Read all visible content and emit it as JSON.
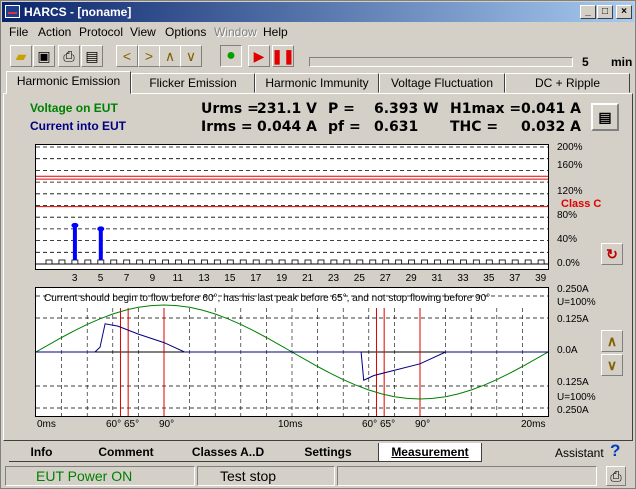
{
  "window": {
    "title": "HARCS - [noname]"
  },
  "menu": [
    "File",
    "Action",
    "Protocol",
    "View",
    "Options",
    "Window",
    "Help"
  ],
  "toolbar": {
    "timer_value": "5",
    "timer_unit": "min"
  },
  "tabs": [
    "Harmonic Emission",
    "Flicker Emission",
    "Harmonic Immunity",
    "Voltage Fluctuation",
    "DC + Ripple"
  ],
  "header": {
    "voltage_label": "Voltage on EUT",
    "current_label": "Current into EUT",
    "urms_label": "Urms =",
    "urms_value": "231.1 V",
    "irms_label": "Irms  =",
    "irms_value": "0.044 A",
    "p_label": "P =",
    "p_value": "6.393 W",
    "pf_label": "pf =",
    "pf_value": "0.631",
    "h1max_label": "H1max =",
    "h1max_value": "0.041 A",
    "thc_label": "THC =",
    "thc_value": "0.032 A"
  },
  "colors": {
    "voltage": "#008000",
    "current": "#000080",
    "limit": "#e00000",
    "bar": "#0000ff"
  },
  "chart_data": [
    {
      "type": "bar",
      "categories": [
        "1",
        "2",
        "3",
        "4",
        "5",
        "6",
        "7",
        "8",
        "9",
        "10",
        "11",
        "12",
        "13",
        "14",
        "15",
        "16",
        "17",
        "18",
        "19",
        "20",
        "21",
        "22",
        "23",
        "24",
        "25",
        "26",
        "27",
        "28",
        "29",
        "30",
        "31",
        "32",
        "33",
        "34",
        "35",
        "36",
        "37",
        "38",
        "39",
        "40"
      ],
      "values": [
        0,
        0,
        66,
        0,
        60,
        0,
        0,
        0,
        0,
        0,
        0,
        0,
        0,
        0,
        0,
        0,
        0,
        0,
        0,
        0,
        0,
        0,
        0,
        0,
        0,
        0,
        0,
        0,
        0,
        0,
        0,
        0,
        0,
        0,
        0,
        0,
        0,
        0,
        0,
        0
      ],
      "x_tick_labels": [
        "3",
        "5",
        "7",
        "9",
        "11",
        "13",
        "15",
        "17",
        "19",
        "21",
        "23",
        "25",
        "27",
        "29",
        "31",
        "33",
        "35",
        "37",
        "39"
      ],
      "y_tick_labels": [
        "200%",
        "160%",
        "120%",
        "80%",
        "40%",
        "0.0%"
      ],
      "limit_lines": [
        98,
        145,
        150
      ],
      "limit_label": "Class C",
      "ylim": [
        0,
        200
      ]
    },
    {
      "type": "line",
      "annotation": "Current should begin to flow before 60°, has his last peak before 65°, and not stop flowing before 90°",
      "y_tick_labels_left": [
        "0.250A",
        "U=100%",
        "0.125A",
        "0.0A",
        "0.125A",
        "U=100%",
        "0.250A"
      ],
      "x_tick_labels": [
        "0ms",
        "60°",
        "65°",
        "90°",
        "10ms",
        "60°",
        "65°",
        "90°",
        "20ms"
      ],
      "xlim": [
        0,
        20
      ],
      "series": [
        {
          "values_x": [
            0,
            0.5,
            1,
            1.5,
            2,
            2.5,
            3,
            3.5,
            4,
            4.5,
            5,
            5.5,
            6,
            6.5,
            7,
            7.5,
            8,
            8.5,
            9,
            9.5,
            10,
            10.5,
            11,
            11.5,
            12,
            12.5,
            13,
            13.5,
            14,
            14.5,
            15,
            15.5,
            16,
            16.5,
            17,
            17.5,
            18,
            18.5,
            19,
            19.5,
            20
          ],
          "values_y": [
            0,
            0.156,
            0.309,
            0.454,
            0.588,
            0.707,
            0.809,
            0.891,
            0.951,
            0.988,
            1,
            0.988,
            0.951,
            0.891,
            0.809,
            0.707,
            0.588,
            0.454,
            0.309,
            0.156,
            0,
            -0.156,
            -0.309,
            -0.454,
            -0.588,
            -0.707,
            -0.809,
            -0.891,
            -0.951,
            -0.988,
            -1,
            -0.988,
            -0.951,
            -0.891,
            -0.809,
            -0.707,
            -0.588,
            -0.454,
            -0.309,
            -0.156,
            0
          ]
        },
        {
          "values_x": [
            0,
            2.3,
            2.5,
            2.7,
            3.2,
            4,
            5,
            5.8,
            6,
            7.6,
            7.8,
            12.7,
            12.8,
            13.2,
            15,
            16,
            16.2,
            20
          ],
          "values_y": [
            0,
            0,
            0.1,
            0.6,
            0.55,
            0.38,
            0.2,
            0,
            0,
            0,
            0,
            0,
            -0.6,
            -0.5,
            -0.25,
            0,
            0,
            0
          ]
        }
      ],
      "markers_ms": [
        3.3,
        3.6,
        5,
        13.3,
        13.6,
        15
      ]
    }
  ],
  "bottom_tabs": [
    "Info",
    "Comment",
    "Classes A..D",
    "Settings",
    "Measurement"
  ],
  "assistant_label": "Assistant",
  "status": {
    "power": "EUT Power ON",
    "test": "Test stop"
  }
}
